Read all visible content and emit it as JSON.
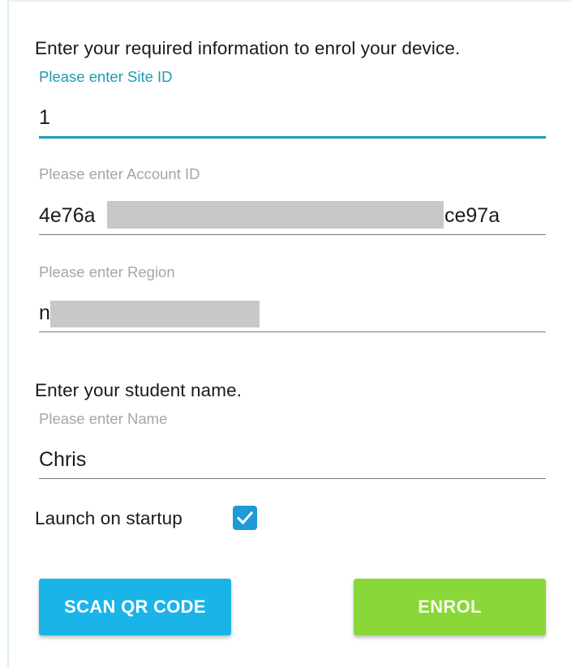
{
  "enrol_section": {
    "title": "Enter your required information to enrol your device."
  },
  "site_id": {
    "label": "Please enter Site ID",
    "value": "1"
  },
  "account_id": {
    "label": "Please enter Account ID",
    "value_start": "4e76a",
    "value_end": "ce97a"
  },
  "region": {
    "label": "Please enter Region",
    "value_start": "n"
  },
  "student_section": {
    "title": "Enter your student name."
  },
  "name": {
    "label": "Please enter Name",
    "value": "Chris"
  },
  "launch_on_startup": {
    "label": "Launch on startup",
    "checked": true
  },
  "buttons": {
    "scan_qr": "SCAN QR CODE",
    "enrol": "ENROL"
  },
  "colors": {
    "accent": "#1b9bb8",
    "scan_button": "#1ab4e8",
    "enrol_button": "#8ad73a",
    "checkbox": "#1e9ad6"
  }
}
